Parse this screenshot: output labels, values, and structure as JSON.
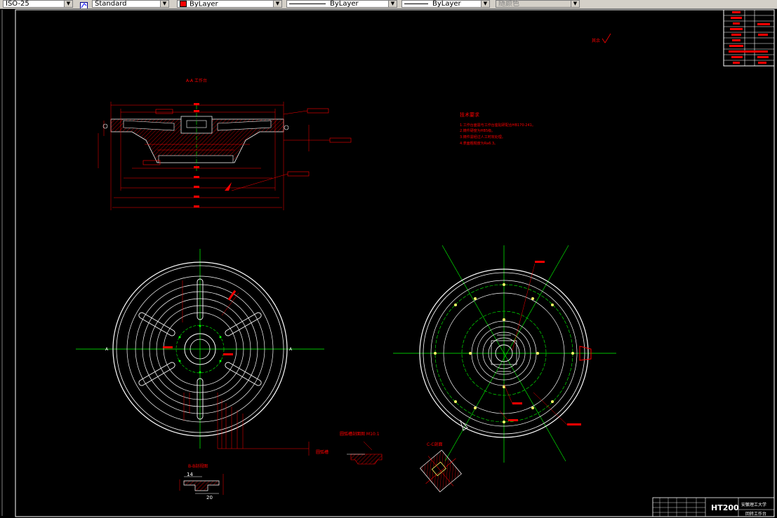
{
  "toolbar": {
    "dimstyle_value": "ISO-25",
    "textstyle_value": "Standard",
    "color_value": "ByLayer",
    "linetype_value": "ByLayer",
    "lineweight_value": "ByLayer",
    "plotstyle_value": "随颜色"
  },
  "drawing": {
    "section_aa_label": "A-A 工作台",
    "tech_req_title": "技术要求",
    "tech_req_lines": [
      "1.工作台面需与工作台座贴研配合HB170-241。",
      "2.铸件硬度为HB5级。",
      "3.铸件需经过人工时效处理。",
      "4.表面粗糙度为Ra6.3。"
    ],
    "roughness_label": "其余",
    "circle_mark_a_left": "A",
    "circle_mark_a_right": "A",
    "groove_label": "圆弧槽",
    "groove_section_label": "圆弧槽剖面图 M10:1",
    "section_cc_label": "C-C剖面",
    "section_bb_label": "B-B剖视图",
    "dim_14": "14",
    "dim_20": "20",
    "material": "HT200",
    "school_name": "安徽理工大学",
    "part_name": "回转工作台"
  },
  "colors": {
    "background": "#000000",
    "outline": "#ffffff",
    "dimension": "#ff0000",
    "centerline": "#00ff00",
    "hatch": "#ff0000",
    "marker": "#ffff00"
  }
}
